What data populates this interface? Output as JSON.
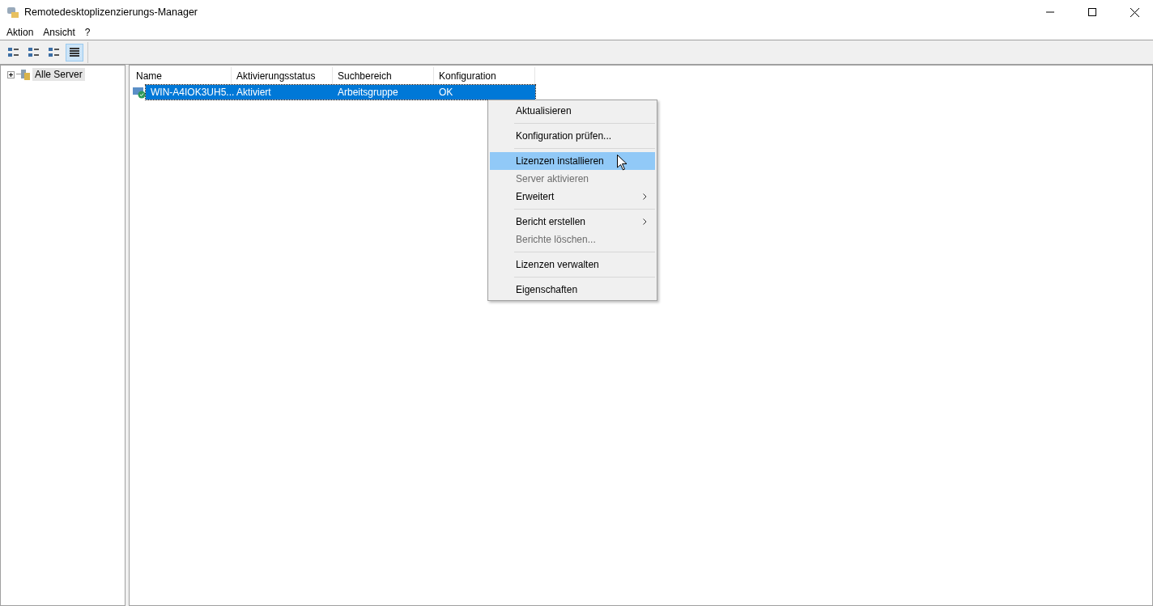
{
  "window": {
    "title": "Remotedesktoplizenzierungs-Manager"
  },
  "menu_bar": [
    "Aktion",
    "Ansicht",
    "?"
  ],
  "toolbar": [
    {
      "selected": false
    },
    {
      "selected": false
    },
    {
      "selected": false
    },
    {
      "selected": true
    }
  ],
  "tree": [
    {
      "label": "Alle Server",
      "expanded": false,
      "selected": true
    }
  ],
  "table": {
    "columns": [
      "Name",
      "Aktivierungsstatus",
      "Suchbereich",
      "Konfiguration"
    ],
    "rows": [
      {
        "selected": true,
        "cells": [
          "WIN-A4IOK3UH5...",
          "Aktiviert",
          "Arbeitsgruppe",
          "OK"
        ]
      }
    ]
  },
  "context_menu": [
    [
      {
        "label": "Aktualisieren",
        "selected": false,
        "disabled": false,
        "submenu": false
      }
    ],
    [
      {
        "label": "Konfiguration prüfen...",
        "selected": false,
        "disabled": false,
        "submenu": false
      }
    ],
    [
      {
        "label": "Lizenzen installieren",
        "selected": true,
        "disabled": false,
        "submenu": false
      },
      {
        "label": "Server aktivieren",
        "selected": false,
        "disabled": true,
        "submenu": false
      },
      {
        "label": "Erweitert",
        "selected": false,
        "disabled": false,
        "submenu": true
      }
    ],
    [
      {
        "label": "Bericht erstellen",
        "selected": false,
        "disabled": false,
        "submenu": true
      },
      {
        "label": "Berichte löschen...",
        "selected": false,
        "disabled": true,
        "submenu": false
      }
    ],
    [
      {
        "label": "Lizenzen verwalten",
        "selected": false,
        "disabled": false,
        "submenu": false
      }
    ],
    [
      {
        "label": "Eigenschaften",
        "selected": false,
        "disabled": false,
        "submenu": false
      }
    ]
  ]
}
